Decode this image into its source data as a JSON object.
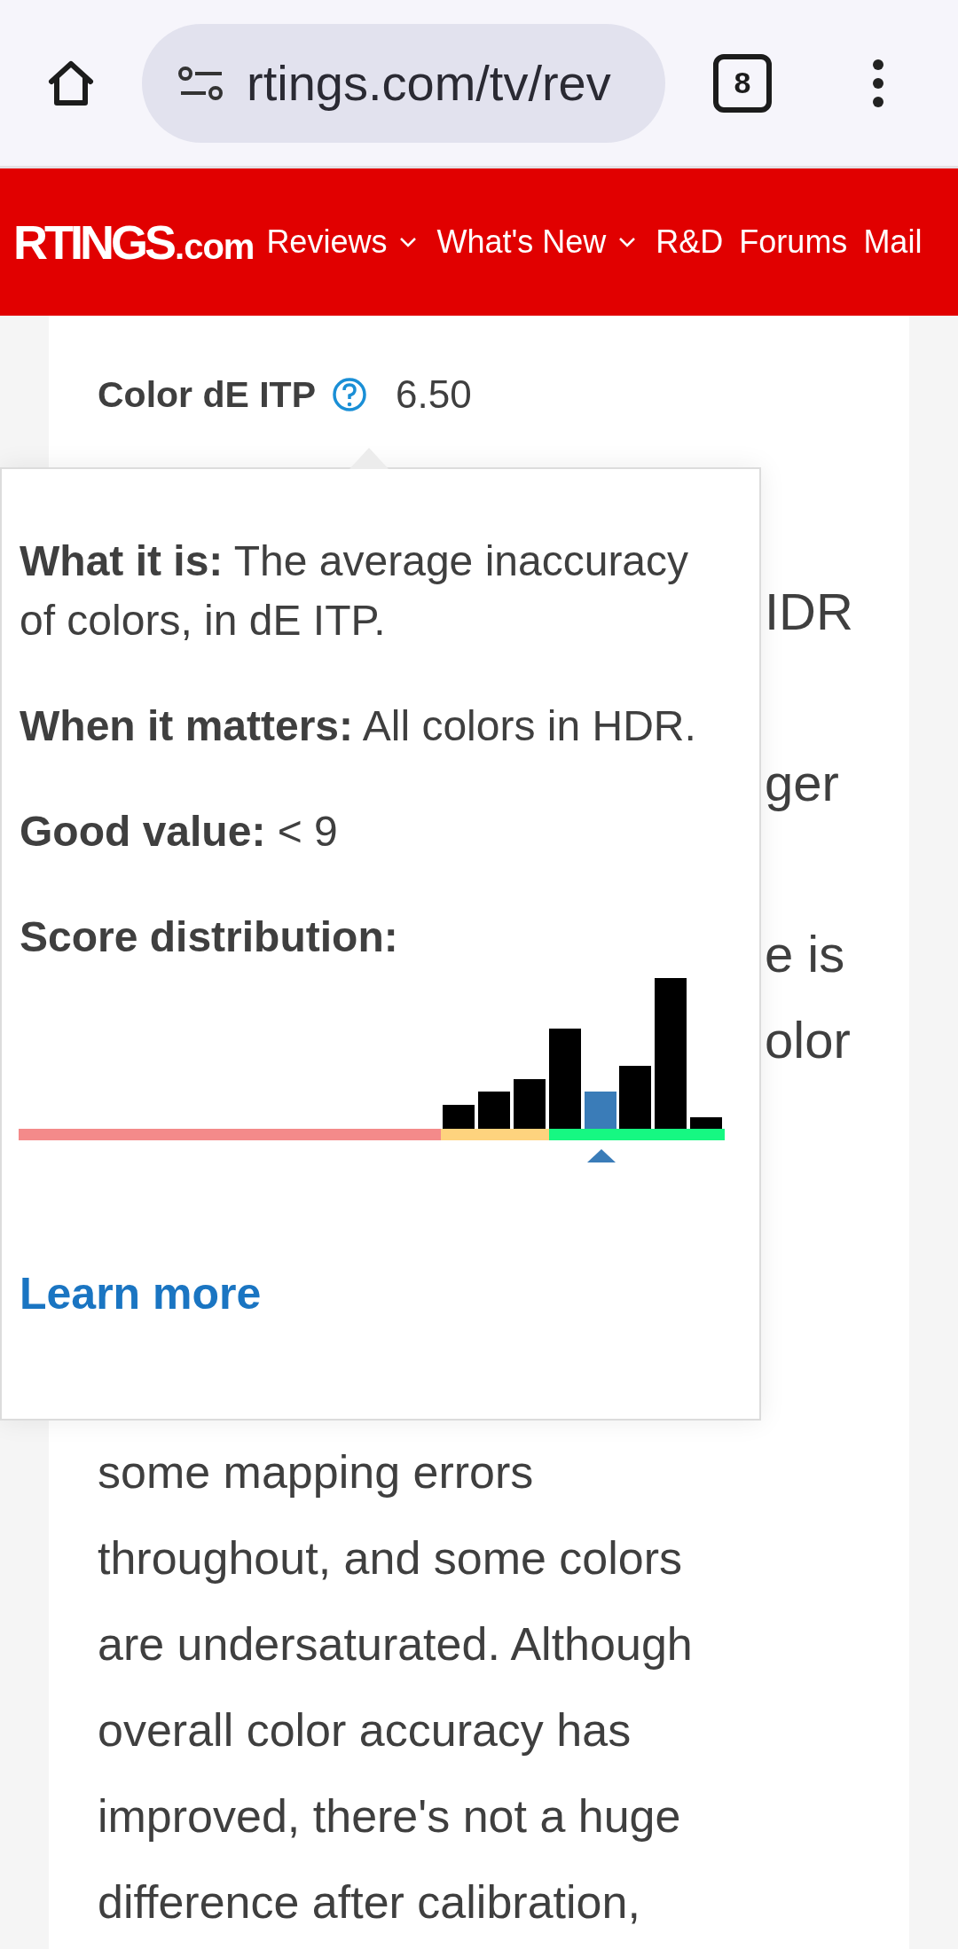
{
  "browser": {
    "url": "rtings.com/tv/rev",
    "tab_count": "8"
  },
  "header": {
    "logo": "RTINGS",
    "logo_suffix": ".com",
    "nav": [
      {
        "label": "Reviews",
        "dropdown": true
      },
      {
        "label": "What's New",
        "dropdown": true
      },
      {
        "label": "R&D",
        "dropdown": false
      },
      {
        "label": "Forums",
        "dropdown": false
      },
      {
        "label": "Mail",
        "dropdown": false
      }
    ]
  },
  "metrics": [
    {
      "name": "Color dE ITP",
      "value": "6.50"
    }
  ],
  "paragraph_fragments": [
    "IDR",
    "ger",
    "e is",
    "olor"
  ],
  "tooltip": {
    "sections": [
      "**What it is:** The average inaccuracy of colors, in dE ITP.",
      "**When it matters:** All colors in HDR.",
      "**Good value:** < 9"
    ],
    "distribution_label": "Score distribution:",
    "learn_more": "Learn more"
  },
  "paragraph_lines": [
    "some mapping errors",
    "throughout, and some colors",
    "are undersaturated. Although",
    "overall color accuracy has",
    "improved, there's not a huge",
    "difference after calibration,"
  ]
}
